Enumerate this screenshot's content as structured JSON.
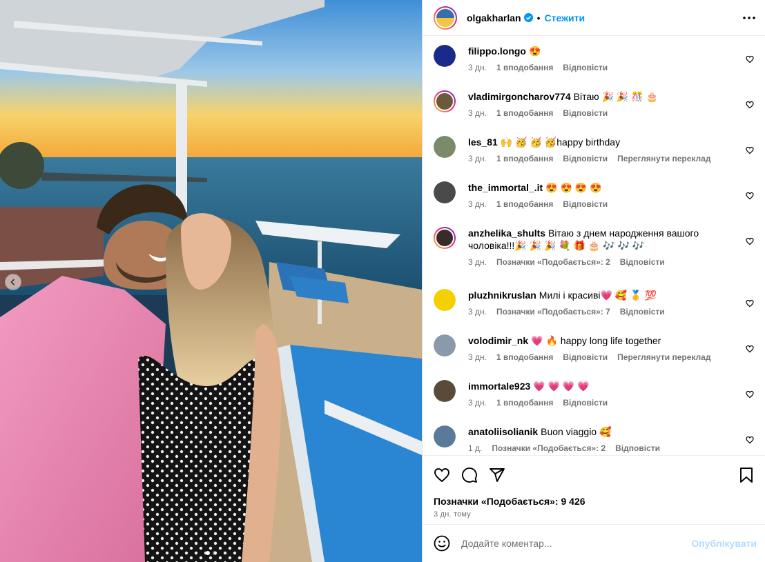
{
  "post": {
    "author": "olgakharlan",
    "verified_icon": "verified-badge-icon",
    "bullet": "•",
    "follow_label": "Стежити",
    "more_icon": "more-horizontal-icon"
  },
  "comments": [
    {
      "user": "filippo.longo",
      "text": "😍",
      "time": "3 дн.",
      "likes": "1 вподобання",
      "reply": "Відповісти",
      "translate": "",
      "avatar_color": "#1a2a8a"
    },
    {
      "user": "vladimirgoncharov774",
      "text": "Вітаю 🎉 🎉 🎊 🎂",
      "time": "3 дн.",
      "likes": "1 вподобання",
      "reply": "Відповісти",
      "translate": "",
      "avatar_color": "#6b5a3a"
    },
    {
      "user": "les_81",
      "text": "🙌 🥳 🥳 🥳happy birthday",
      "time": "3 дн.",
      "likes": "1 вподобання",
      "reply": "Відповісти",
      "translate": "Переглянути переклад",
      "avatar_color": "#7a8a6a"
    },
    {
      "user": "the_immortal_.it",
      "text": "😍 😍 😍 😍",
      "time": "3 дн.",
      "likes": "1 вподобання",
      "reply": "Відповісти",
      "translate": "",
      "avatar_color": "#4a4a4a"
    },
    {
      "user": "anzhelika_shults",
      "text": "Вітаю з днем народження вашого чоловіка!!!🎉 🎉 🎉 💐 🎁 🎂 🎶 🎶 🎶",
      "time": "3 дн.",
      "likes": "Позначки «Подобається»: 2",
      "reply": "Відповісти",
      "translate": "",
      "avatar_color": "#3a2a2a"
    },
    {
      "user": "pluzhnikruslan",
      "text": "Милі і красиві💗 🥰 🥇 💯",
      "time": "3 дн.",
      "likes": "Позначки «Подобається»: 7",
      "reply": "Відповісти",
      "translate": "",
      "avatar_color": "#f5d000"
    },
    {
      "user": "volodimir_nk",
      "text": "💗 🔥 happy long life together",
      "time": "3 дн.",
      "likes": "1 вподобання",
      "reply": "Відповісти",
      "translate": "Переглянути переклад",
      "avatar_color": "#8a9aaa"
    },
    {
      "user": "immortale923",
      "text": "💗 💗 💗 💗",
      "time": "3 дн.",
      "likes": "1 вподобання",
      "reply": "Відповісти",
      "translate": "",
      "avatar_color": "#5a4a3a"
    },
    {
      "user": "anatoliisolianik",
      "text": "Buon viaggio 🥰",
      "time": "1 д.",
      "likes": "Позначки «Подобається»: 2",
      "reply": "Відповісти",
      "translate": "",
      "avatar_color": "#5a7a9a"
    }
  ],
  "actions": {
    "like_icon": "heart-icon",
    "comment_icon": "comment-icon",
    "share_icon": "share-icon",
    "save_icon": "bookmark-icon",
    "likes_count": "Позначки «Подобається»: 9 426",
    "date": "3 дн. тому"
  },
  "composer": {
    "emoji_icon": "emoji-icon",
    "placeholder": "Додайте коментар...",
    "post_label": "Опублікувати"
  },
  "media": {
    "carousel_count": 2,
    "carousel_active": 0
  }
}
